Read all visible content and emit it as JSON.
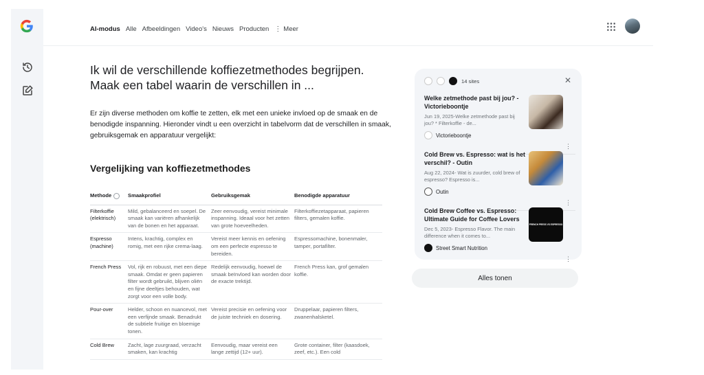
{
  "nav": {
    "tabs": [
      {
        "label": "AI-modus"
      },
      {
        "label": "Alle"
      },
      {
        "label": "Afbeeldingen"
      },
      {
        "label": "Video's"
      },
      {
        "label": "Nieuws"
      },
      {
        "label": "Producten"
      },
      {
        "label": "Meer"
      }
    ],
    "more_icon": "vertical-dots-icon",
    "apps_icon": "apps-grid-icon"
  },
  "rail": {
    "icons": [
      "history-icon",
      "new-chat-icon"
    ]
  },
  "query": "Ik wil de verschillende koffiezetmethodes begrijpen. Maak een tabel waarin de verschillen in ...",
  "intro": "Er zijn diverse methoden om koffie te zetten, elk met een unieke invloed op de smaak en de benodigde inspanning. Hieronder vindt u een overzicht in tabelvorm dat de verschillen in smaak, gebruiksgemak en apparatuur vergelijkt:",
  "heading": {
    "part1": "Vergelijking van koffiezetmethodes"
  },
  "table": {
    "headers": [
      "Methode",
      "Smaakprofiel",
      "Gebruiksgemak",
      "Benodigde apparatuur"
    ],
    "rows": [
      [
        "Filterkoffie (elektrisch)",
        "Mild, gebalanceerd en soepel. De smaak kan variëren afhankelijk van de bonen en het apparaat.",
        "Zeer eenvoudig, vereist minimale inspanning. Ideaal voor het zetten van grote hoeveelheden.",
        "Filterkoffiezetapparaat, papieren filters, gemalen koffie."
      ],
      [
        "Espresso (machine)",
        "Intens, krachtig, complex en romig, met een rijke crema-laag.",
        "Vereist meer kennis en oefening om een perfecte espresso te bereiden.",
        "Espressomachine, bonenmaler, tamper, portafilter."
      ],
      [
        "French Press",
        "Vol, rijk en robuust, met een diepe smaak. Omdat er geen papieren filter wordt gebruikt, blijven oliën en fijne deeltjes behouden, wat zorgt voor een volle body.",
        "Redelijk eenvoudig, hoewel de smaak beïnvloed kan worden door de exacte trektijd.",
        "French Press kan, grof gemalen koffie."
      ],
      [
        "Pour-over",
        "Helder, schoon en nuancevol, met een verfijnde smaak. Benadrukt de subtiele fruitige en bloemige tonen.",
        "Vereist precisie en oefening voor de juiste techniek en dosering.",
        "Druppelaar, papieren filters, zwanenhalsketel."
      ],
      [
        "Cold Brew",
        "Zacht, lage zuurgraad, verzacht smaken, kan krachtig",
        "Eenvoudig, maar vereist een lange zettijd (12+ uur).",
        "Grote container, filter (kaasdoek, zeef, etc.). Een cold"
      ]
    ]
  },
  "sources": {
    "count_label": "14 sites",
    "cards": [
      {
        "title": "Welke zetmethode past bij jou? - Victorieboontje",
        "snippet": "Jun 19, 2025-Welke zetmethode past bij jou? * Filterkoffie - de...",
        "site": "Victorieboontje"
      },
      {
        "title": "Cold Brew vs. Espresso: wat is het verschil? - Outin",
        "snippet": "Aug 22, 2024- Wat is zuurder, cold brew of espresso? Espresso is...",
        "site": "Outin"
      },
      {
        "title": "Cold Brew Coffee vs. Espresso: Ultimate Guide for Coffee Lovers",
        "snippet": "Dec 5, 2023- Espresso Flavor. The main difference when it comes to...",
        "site": "Street Smart Nutrition",
        "thumb_text": "FRENCH PRESS VS ESPRESSO"
      }
    ],
    "show_all": "Alles tonen"
  },
  "colors": {
    "accent": "#4a76b7",
    "panel": "#f3f5f8"
  }
}
